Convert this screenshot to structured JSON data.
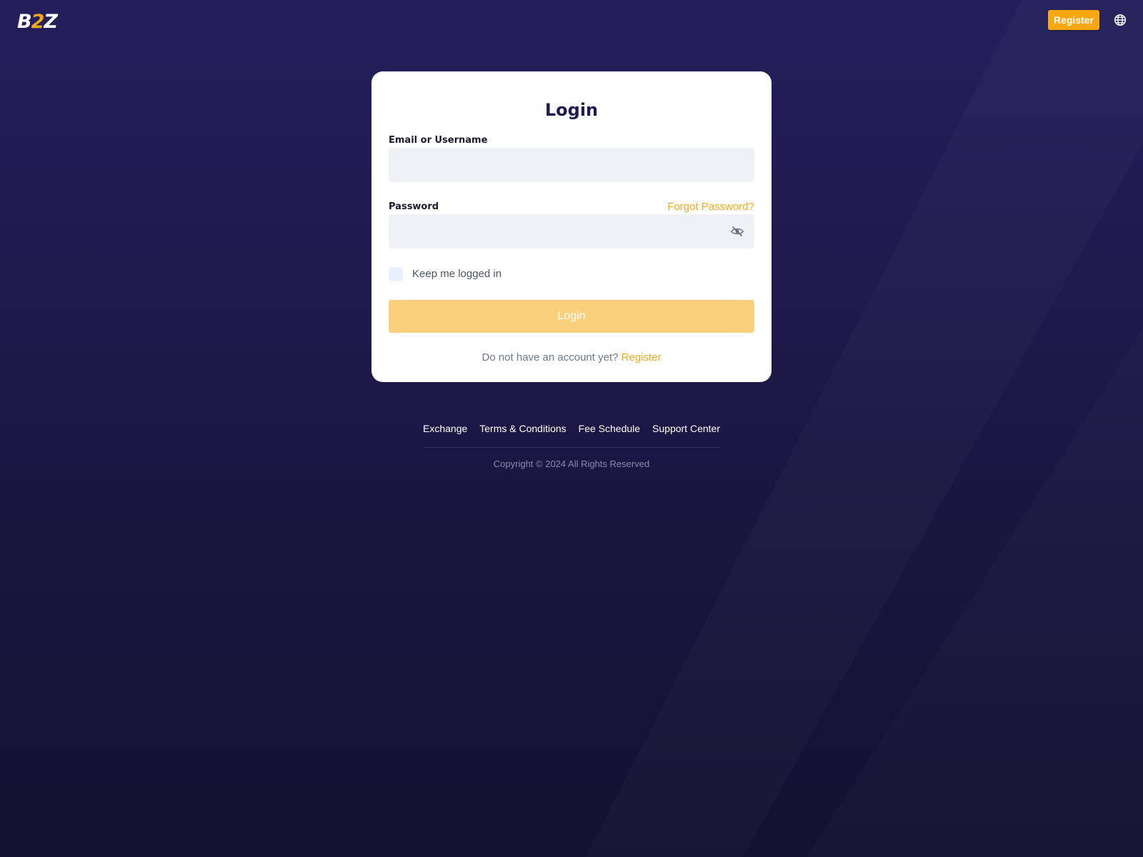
{
  "header": {
    "logo_left": "B",
    "logo_mid": "2",
    "logo_right": "Z",
    "register_label": "Register",
    "language_icon": "globe-icon"
  },
  "login_form": {
    "title": "Login",
    "email_label": "Email or Username",
    "email_value": "",
    "password_label": "Password",
    "password_value": "",
    "forgot_password": "Forgot Password?",
    "visibility_icon": "eye-off-icon",
    "keep_logged_in": "Keep me logged in",
    "keep_logged_in_checked": false,
    "submit_label": "Login",
    "no_account_text": "Do not have an account yet?",
    "register_link": "Register"
  },
  "footer": {
    "links": [
      "Exchange",
      "Terms & Conditions",
      "Fee Schedule",
      "Support Center"
    ],
    "copyright": "Copyright © 2024 All Rights Reserved"
  },
  "colors": {
    "accent": "#f7a70f",
    "link": "#f3a71d",
    "button_disabled": "#fbd07c",
    "background_top": "#241f5c",
    "background_bottom": "#141131",
    "title": "#1f1b56",
    "input_bg": "#eef2f7"
  }
}
